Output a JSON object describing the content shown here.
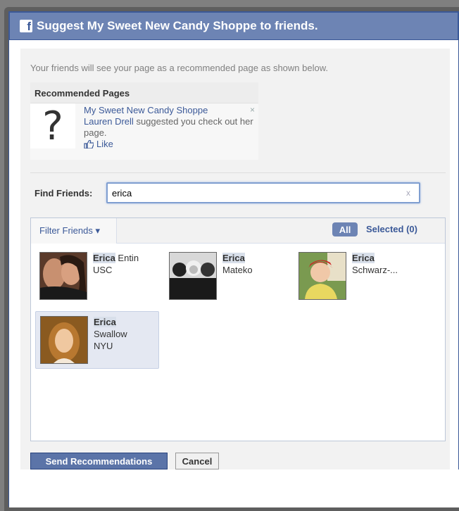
{
  "dialog": {
    "logo_letter": "f",
    "title": "Suggest My Sweet New Candy Shoppe to friends."
  },
  "intro_text": "Your friends will see your page as a recommended page as shown below.",
  "recommended": {
    "header": "Recommended Pages",
    "page_name": "My Sweet New Candy Shoppe",
    "suggester": "Lauren Drell",
    "suggest_text": "suggested you check out her page.",
    "like_label": "Like",
    "close_glyph": "×",
    "thumb_glyph": "?"
  },
  "find": {
    "label": "Find Friends:",
    "value": "erica",
    "clear_glyph": "x"
  },
  "friends_panel": {
    "filter_label": "Filter Friends ▾",
    "tab_all": "All",
    "tab_selected": "Selected (0)",
    "friends": [
      {
        "first": "Erica",
        "last": " Entin",
        "network": "USC",
        "selected": false
      },
      {
        "first": "Erica",
        "last": "Mateko",
        "network": "",
        "selected": false
      },
      {
        "first": "Erica",
        "last": "Schwarz-...",
        "network": "",
        "selected": false
      },
      {
        "first": "Erica",
        "last": "Swallow",
        "network": "NYU",
        "selected": true
      }
    ]
  },
  "actions": {
    "send_label": "Send Recommendations",
    "cancel_label": "Cancel"
  },
  "colors": {
    "title_bar": "#6d84b4",
    "link": "#3b5998",
    "send_button": "#5b74a8"
  }
}
